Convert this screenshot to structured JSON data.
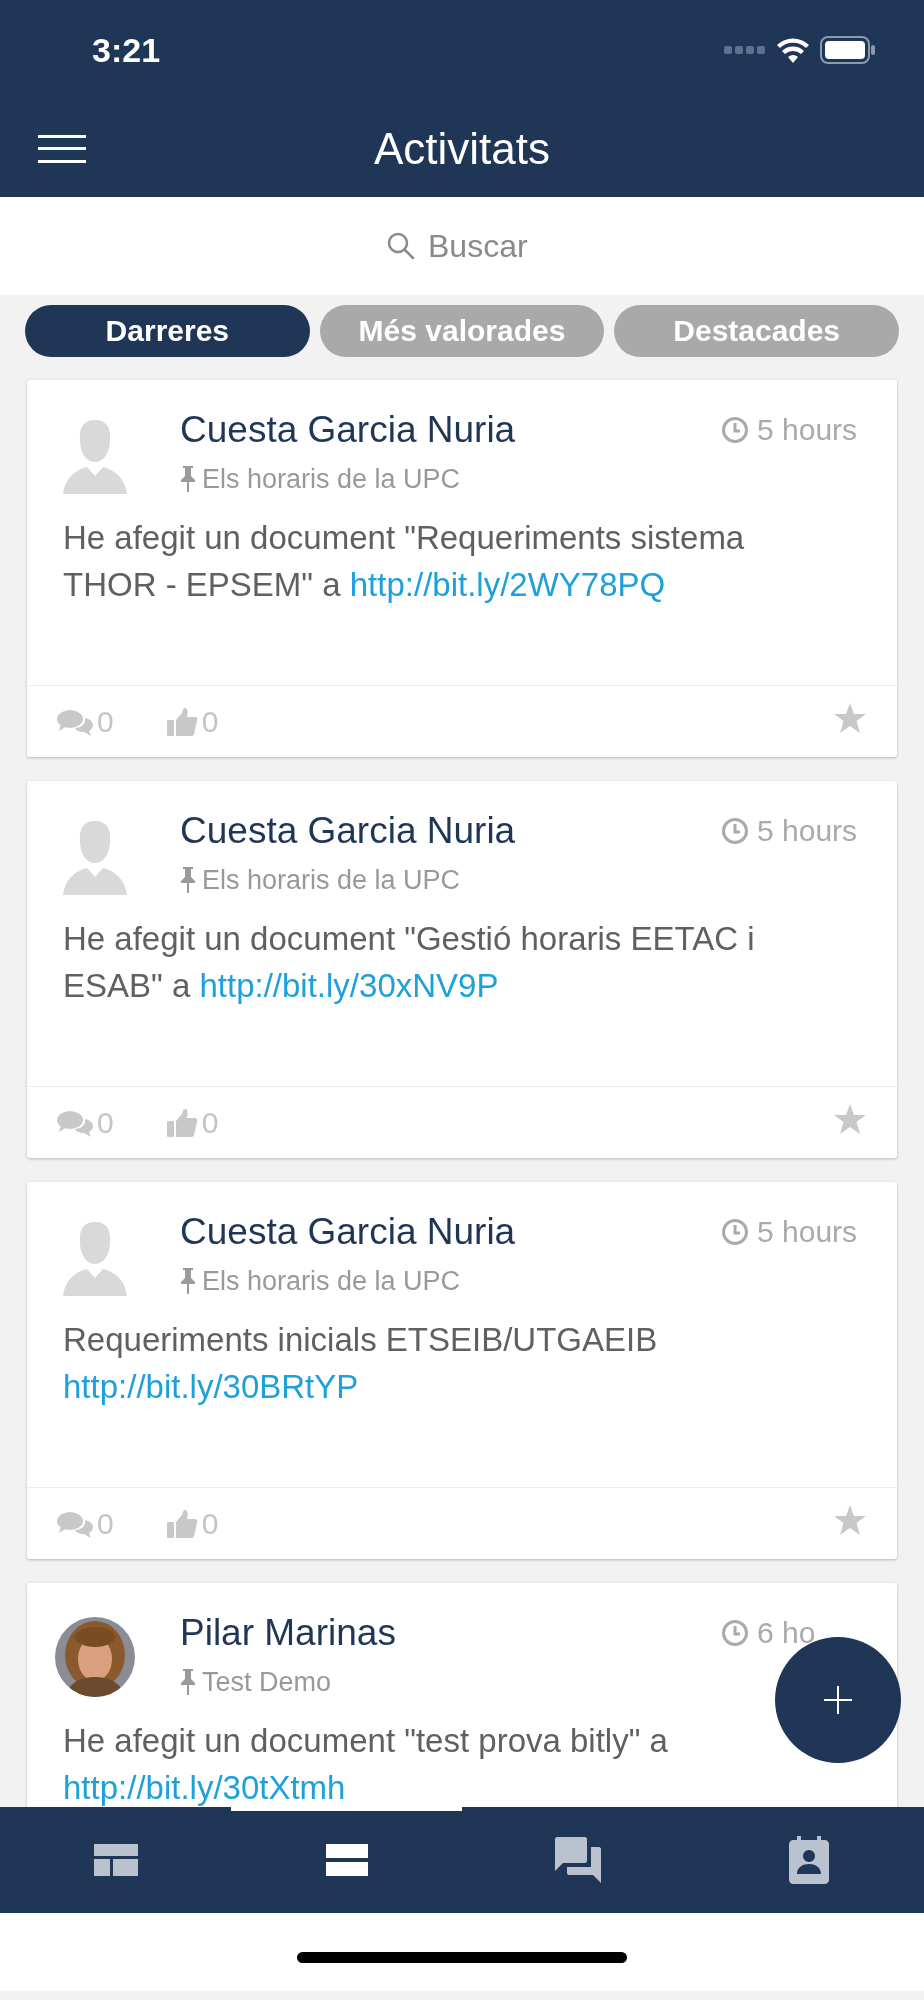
{
  "status_bar": {
    "time": "3:21"
  },
  "header": {
    "title": "Activitats"
  },
  "search": {
    "placeholder": "Buscar"
  },
  "tabs": [
    {
      "label": "Darreres",
      "selected": true
    },
    {
      "label": "Més valorades",
      "selected": false
    },
    {
      "label": "Destacades",
      "selected": false
    }
  ],
  "activities": [
    {
      "author": "Cuesta Garcia Nuria",
      "kind": "placeholder",
      "time": "5 hours",
      "group": "Els horaris de la UPC",
      "text": "He afegit un document \"Requeriments sistema THOR - EPSEM\" a",
      "link": "http://bit.ly/2WY78PQ",
      "comments": "0",
      "likes": "0",
      "starred": false
    },
    {
      "author": "Cuesta Garcia Nuria",
      "kind": "placeholder",
      "time": "5 hours",
      "group": "Els horaris de la UPC",
      "text": "He afegit un document \"Gestió horaris EETAC i ESAB\" a",
      "link": "http://bit.ly/30xNV9P",
      "comments": "0",
      "likes": "0",
      "starred": false
    },
    {
      "author": "Cuesta Garcia Nuria",
      "kind": "placeholder",
      "time": "5 hours",
      "group": "Els horaris de la UPC",
      "text": "Requeriments inicials ETSEIB/UTGAEIB",
      "link": "http://bit.ly/30BRtYP",
      "comments": "0",
      "likes": "0",
      "starred": false
    },
    {
      "author": "Pilar Marinas",
      "kind": "picture",
      "time": "6 ho",
      "group": "Test Demo",
      "text": "He afegit un document \"test prova bitly\" a",
      "link": "http://bit.ly/30tXtmh"
    }
  ],
  "bottom_nav": [
    {
      "kind": "dashboard",
      "selected": false
    },
    {
      "kind": "list",
      "selected": true
    },
    {
      "kind": "chat",
      "selected": false
    },
    {
      "kind": "contact",
      "selected": false
    }
  ]
}
